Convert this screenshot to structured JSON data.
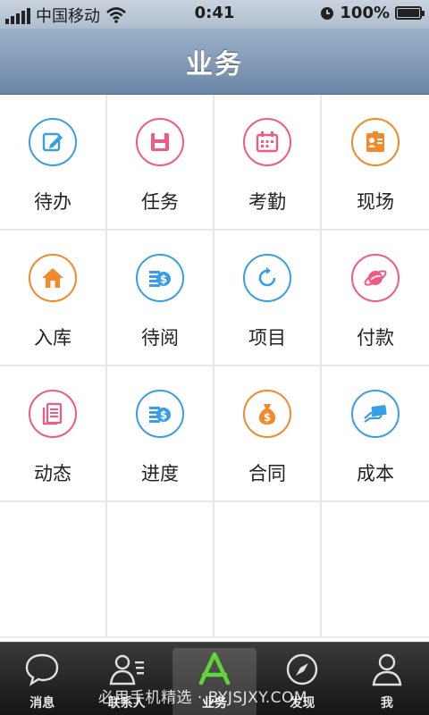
{
  "status_bar": {
    "carrier": "中国移动",
    "time": "0:41",
    "battery": "100%",
    "battery_level": 1.0
  },
  "header": {
    "title": "业务"
  },
  "grid": [
    {
      "label": "待办",
      "icon": "edit-icon",
      "color": "#3a9ee4"
    },
    {
      "label": "任务",
      "icon": "floppy-icon",
      "color": "#ef5a86"
    },
    {
      "label": "考勤",
      "icon": "calendar-icon",
      "color": "#ef5a86"
    },
    {
      "label": "现场",
      "icon": "id-card-icon",
      "color": "#f08a2c"
    },
    {
      "label": "入库",
      "icon": "home-icon",
      "color": "#f08a2c"
    },
    {
      "label": "待阅",
      "icon": "coins-icon",
      "color": "#3a9ee4"
    },
    {
      "label": "项目",
      "icon": "refresh-icon",
      "color": "#3a9ee4"
    },
    {
      "label": "付款",
      "icon": "planet-icon",
      "color": "#ef5a86"
    },
    {
      "label": "动态",
      "icon": "document-icon",
      "color": "#ef5a86"
    },
    {
      "label": "进度",
      "icon": "coins-icon",
      "color": "#3a9ee4"
    },
    {
      "label": "合同",
      "icon": "money-bag-icon",
      "color": "#f08a2c"
    },
    {
      "label": "成本",
      "icon": "card-icon",
      "color": "#3a9ee4"
    }
  ],
  "tabs": [
    {
      "label": "消息",
      "icon": "chat-bubble-icon"
    },
    {
      "label": "联系人",
      "icon": "contacts-icon"
    },
    {
      "label": "业务",
      "icon": "app-store-icon",
      "active": true,
      "accent": "#5ed63a"
    },
    {
      "label": "发现",
      "icon": "compass-icon"
    },
    {
      "label": "我",
      "icon": "person-icon"
    }
  ],
  "watermark": "必用手机精选 · BYJSJXY.COM"
}
